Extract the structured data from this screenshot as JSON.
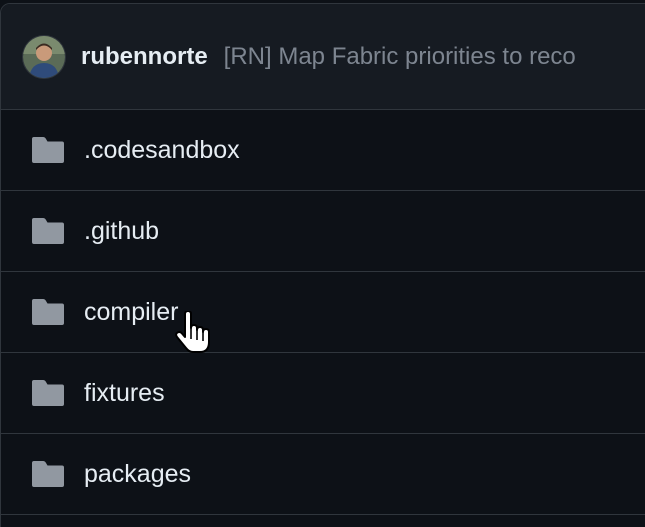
{
  "latest_commit": {
    "author": "rubennorte",
    "message": "[RN] Map Fabric priorities to reco"
  },
  "items": [
    {
      "name": ".codesandbox",
      "icon": "folder-icon"
    },
    {
      "name": ".github",
      "icon": "folder-icon"
    },
    {
      "name": "compiler",
      "icon": "folder-icon"
    },
    {
      "name": "fixtures",
      "icon": "folder-icon"
    },
    {
      "name": "packages",
      "icon": "folder-icon"
    }
  ],
  "colors": {
    "background": "#0d1117",
    "header_background": "#161b22",
    "border": "#30363d",
    "text": "#e6edf3",
    "muted_text": "#7d8590",
    "folder_icon": "#9198a1"
  }
}
